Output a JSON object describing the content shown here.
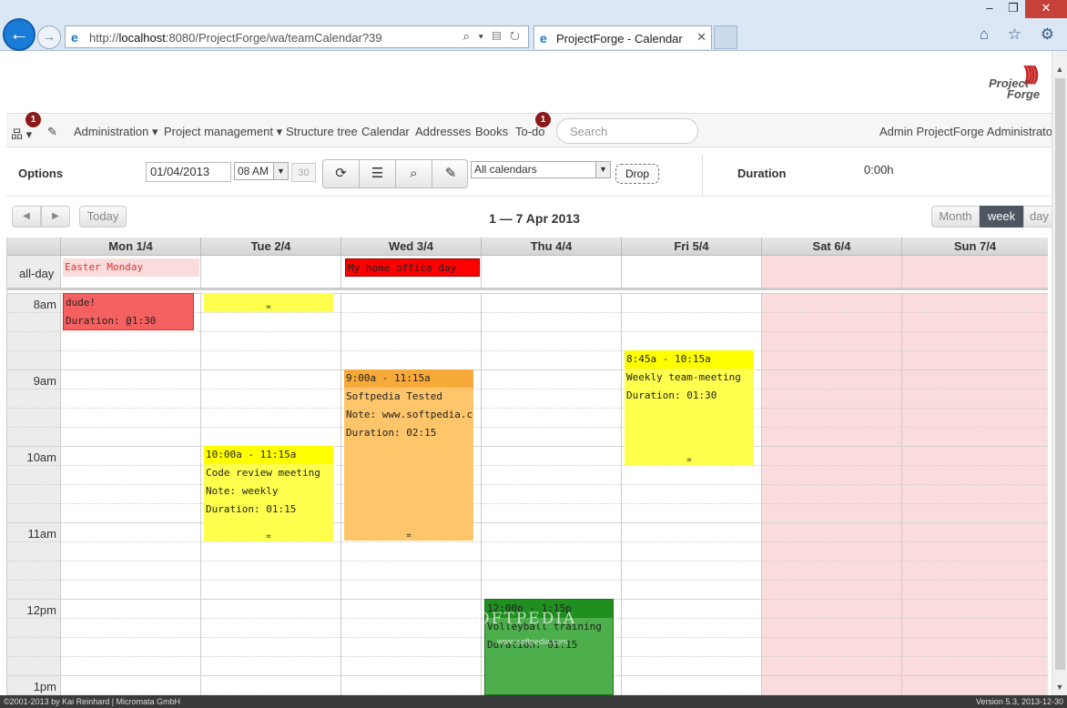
{
  "browser": {
    "back_icon": "←",
    "forward_icon": "→",
    "url_prefix": "http://",
    "url_host": "localhost",
    "url_rest": ":8080/ProjectForge/wa/teamCalendar?39",
    "addr_tools": "⌕ ▾ ▤ ↻",
    "tab_title": "ProjectForge - Calendar",
    "tab_close": "✕",
    "win_min": "–",
    "win_max": "❐",
    "win_close": "✕",
    "ie_icons": "⌂ ☆ ⚙"
  },
  "logo": {
    "line1": "Project",
    "line2": "Forge"
  },
  "menu": {
    "tree_icon": "品 ▾",
    "pencil_icon": "✎",
    "badge_left": "1",
    "badge_todo": "1",
    "items": [
      "Administration ▾",
      "Project management ▾",
      "Structure tree",
      "Calendar",
      "Addresses",
      "Books",
      "To-do"
    ],
    "search_placeholder": "Search",
    "user": "Admin ProjectForge Administrator ▾"
  },
  "options": {
    "label": "Options",
    "date": "01/04/2013",
    "time": "08 AM",
    "thirty": "30",
    "icons": [
      "⟳",
      "☰",
      "⌕",
      "✎"
    ],
    "calendars": "All calendars",
    "drop": "Drop",
    "duration_label": "Duration",
    "duration_value": "0:00h"
  },
  "calendar": {
    "prev_icon": "◀",
    "next_icon": "▶",
    "today": "Today",
    "title": "1 — 7 Apr 2013",
    "views": [
      "Month",
      "week",
      "day"
    ],
    "days": [
      "Mon 1/4",
      "Tue 2/4",
      "Wed 3/4",
      "Thu 4/4",
      "Fri 5/4",
      "Sat 6/4",
      "Sun 7/4"
    ],
    "allday_label": "all-day",
    "hours": [
      "8am",
      "9am",
      "10am",
      "11am",
      "12pm",
      "1pm"
    ],
    "allday_events": [
      {
        "title": "Easter Monday",
        "color": "#fadcdc",
        "text_color": "#d33"
      },
      {
        "title": "My home office day",
        "color": "#ff0000",
        "text_color": "#222"
      }
    ],
    "events": [
      {
        "lines": [
          "dude!",
          "Duration: 01:30"
        ],
        "grip": "=",
        "color": "#f56060",
        "border": "#c33"
      },
      {
        "lines": [],
        "grip": "=",
        "color": "#ffff4d",
        "border": "#dddd33"
      },
      {
        "time": "9:00a - 11:15a",
        "lines": [
          "Softpedia Tested",
          "Note: www.softpedia.com",
          "Duration: 02:15"
        ],
        "grip": "=",
        "color": "#fec56a",
        "head": "#f7a93a"
      },
      {
        "time": "8:45a - 10:15a",
        "lines": [
          "Weekly team-meeting",
          "Duration: 01:30"
        ],
        "grip": "=",
        "color": "#ffff4d",
        "head": "#ffff00"
      },
      {
        "time": "10:00a - 11:15a",
        "lines": [
          "Code review meeting",
          "Note: weekly",
          "Duration: 01:15"
        ],
        "grip": "=",
        "color": "#ffff4d",
        "head": "#ffff00"
      },
      {
        "time": "12:00p - 1:15p",
        "lines": [
          "Volleyball training",
          "Duration: 01:15"
        ],
        "grip": "=",
        "color": "#4caf4c",
        "head": "#1f8f1f"
      }
    ],
    "watermark": "SOFTPEDIA",
    "watermark_url": "www.softpedia.com"
  },
  "footer": {
    "left": "©2001-2013 by Kai Reinhard | Micromata GmbH",
    "right": "Version 5.3, 2013-12-30"
  }
}
